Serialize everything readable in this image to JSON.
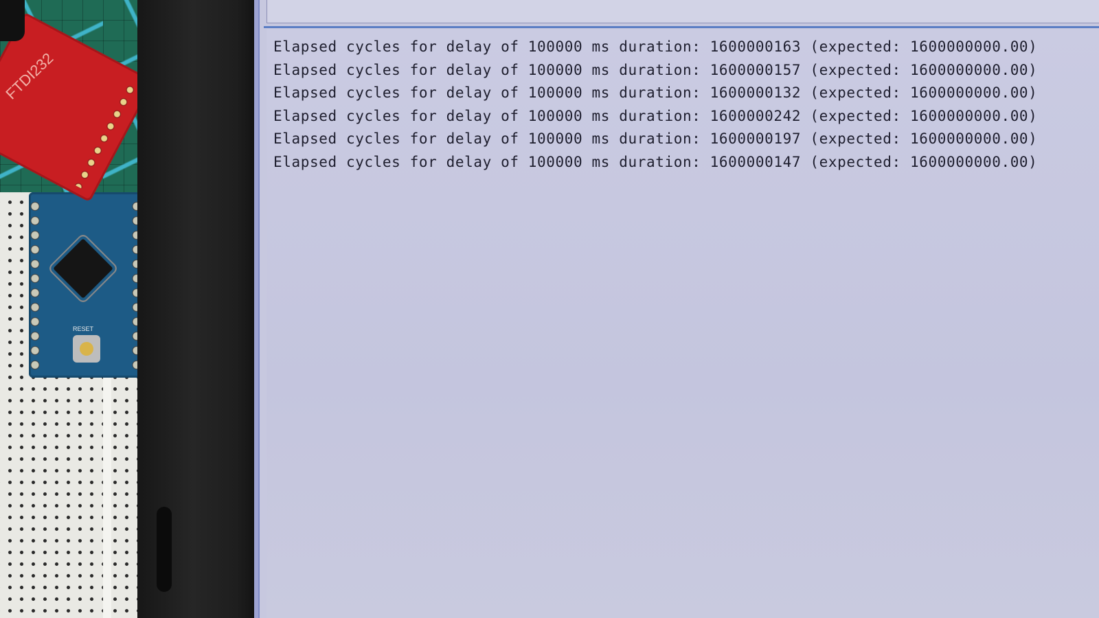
{
  "board": {
    "ftdi_label": "FTDI232",
    "reset_label": "RESET"
  },
  "serial_monitor": {
    "input_value": "",
    "lines": [
      "Elapsed cycles for delay of 100000 ms duration: 1600000163 (expected: 1600000000.00)",
      "Elapsed cycles for delay of 100000 ms duration: 1600000157 (expected: 1600000000.00)",
      "Elapsed cycles for delay of 100000 ms duration: 1600000132 (expected: 1600000000.00)",
      "Elapsed cycles for delay of 100000 ms duration: 1600000242 (expected: 1600000000.00)",
      "Elapsed cycles for delay of 100000 ms duration: 1600000197 (expected: 1600000000.00)",
      "Elapsed cycles for delay of 100000 ms duration: 1600000147 (expected: 1600000000.00)"
    ]
  },
  "colors": {
    "screen_bg": "#c7c8df",
    "text": "#1e1e2e",
    "divider": "#5c7ec4"
  }
}
